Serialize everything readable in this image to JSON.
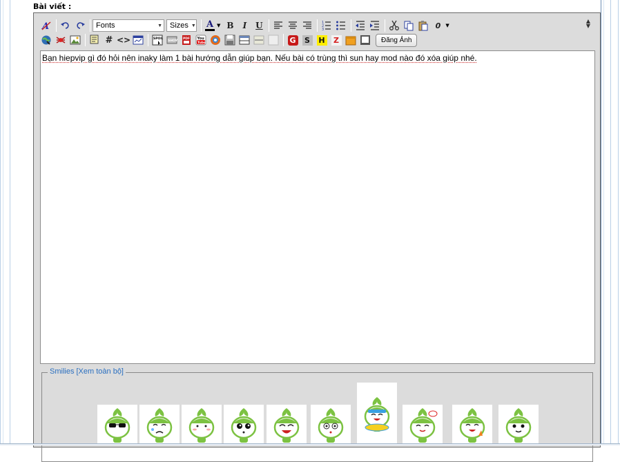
{
  "post": {
    "label": "Bài viết :"
  },
  "toolbar": {
    "font_select": "Fonts",
    "size_select": "Sizes",
    "upload_button": "Đăng Ảnh",
    "buttons_row1": [
      "remove-format",
      "undo",
      "redo",
      "text-color",
      "bold",
      "italic",
      "underline",
      "align-left",
      "align-center",
      "align-right",
      "ordered-list",
      "unordered-list",
      "outdent",
      "indent",
      "cut",
      "copy",
      "paste",
      "attach"
    ],
    "buttons_row2": [
      "link",
      "unlink",
      "image",
      "quote",
      "hash",
      "code",
      "php",
      "spoil",
      "email",
      "pdf",
      "youtube",
      "flash",
      "save",
      "table",
      "hr",
      "blank",
      "google",
      "s",
      "h",
      "z",
      "box",
      "screen"
    ],
    "bold_glyph": "B",
    "italic_glyph": "I",
    "underline_glyph": "U",
    "hash_glyph": "#",
    "code_glyph": "<>",
    "attach_glyph": "0",
    "color_glyph": "A",
    "g_glyph": "G",
    "s_glyph": "S",
    "h_glyph": "H",
    "z_glyph": "Z"
  },
  "editor": {
    "content": "Bạn hiepvip gì đó hỏi nên inaky làm 1 bài hướng dẫn giúp bạn. Nếu bài có trùng thì sun hay mod nào đó xóa giúp nhé."
  },
  "smilies": {
    "legend": "Smilies [Xem toàn bộ]",
    "items": [
      "smiley-sunglasses",
      "smiley-crying",
      "smiley-shy",
      "smiley-surprised",
      "smiley-laughing",
      "smiley-dizzy",
      "smiley-swimming",
      "smiley-bye",
      "smiley-victory",
      "smiley-smile"
    ]
  },
  "colors": {
    "toolbar_bg": "#dcdcdc",
    "link_blue": "#2a6fc0",
    "smiley_green": "#7cc242"
  }
}
